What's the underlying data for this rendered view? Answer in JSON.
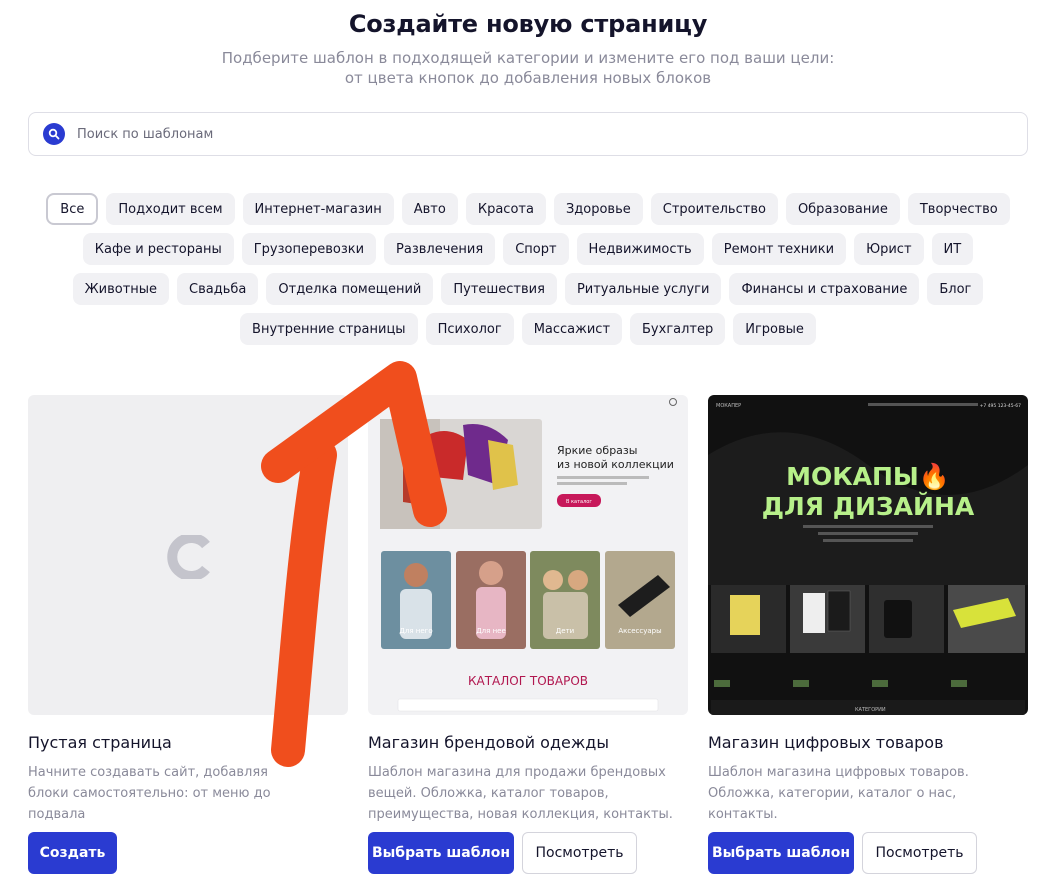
{
  "header": {
    "title": "Создайте новую страницу",
    "subtitle_line1": "Подберите шаблон в подходящей категории и измените его под ваши цели:",
    "subtitle_line2": "от цвета кнопок до добавления новых блоков"
  },
  "search": {
    "placeholder": "Поиск по шаблонам"
  },
  "tags": [
    "Все",
    "Подходит всем",
    "Интернет-магазин",
    "Авто",
    "Красота",
    "Здоровье",
    "Строительство",
    "Образование",
    "Творчество",
    "Кафе и рестораны",
    "Грузоперевозки",
    "Развлечения",
    "Спорт",
    "Недвижимость",
    "Ремонт техники",
    "Юрист",
    "ИТ",
    "Животные",
    "Свадьба",
    "Отделка помещений",
    "Путешествия",
    "Ритуальные услуги",
    "Финансы и страхование",
    "Блог",
    "Внутренние страницы",
    "Психолог",
    "Массажист",
    "Бухгалтер",
    "Игровые"
  ],
  "active_tag": "Все",
  "cards": [
    {
      "title": "Пустая страница",
      "description": "Начните создавать сайт, добавляя блоки самостоятельно: от меню до подвала",
      "primary_button": "Создать",
      "logo_letter": "C"
    },
    {
      "title": "Магазин брендовой одежды",
      "description": "Шаблон магазина для продажи брендовых вещей. Обложка, каталог товаров, преимущества, новая коллекция, контакты.",
      "primary_button": "Выбрать шаблон",
      "secondary_button": "Посмотреть",
      "preview": {
        "hero_title_1": "Яркие образы",
        "hero_title_2": "из новой коллекции",
        "hero_button": "В каталог",
        "categories": [
          "Для него",
          "Для нее",
          "Дети",
          "Аксессуары"
        ],
        "catalog_title": "КАТАЛОГ ТОВАРОВ"
      }
    },
    {
      "title": "Магазин цифровых товаров",
      "description": "Шаблон магазина цифровых товаров. Обложка, категории, каталог о нас, контакты.",
      "primary_button": "Выбрать шаблон",
      "secondary_button": "Посмотреть",
      "preview": {
        "logo": "МОКАПЕР",
        "phone": "+7 495 123-45-67",
        "hero_line1": "МОКАПЫ🔥",
        "hero_line2": "ДЛЯ ДИЗАЙНА",
        "footer_label": "КАТЕГОРИИ"
      }
    }
  ],
  "colors": {
    "accent": "#2a3bd1",
    "arrow": "#f04e1d",
    "neon": "#b7f08a"
  }
}
